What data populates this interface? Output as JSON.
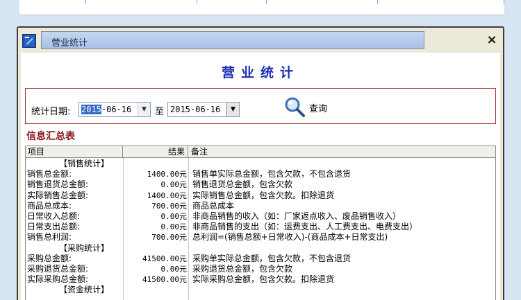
{
  "window": {
    "title": "营业统计",
    "close_symbol": "×"
  },
  "heading": "营业统计",
  "filter": {
    "date_label": "统计日期:",
    "from_year": "2015",
    "from_rest": "-06-16",
    "to_label": "至",
    "to_date": "2015-06-16",
    "query_label": "查询"
  },
  "section_title": "信息汇总表",
  "table": {
    "headers": [
      "项目",
      "结果",
      "备注"
    ],
    "rows": [
      {
        "type": "sec",
        "name": "【销售统计】",
        "value": "",
        "note": ""
      },
      {
        "type": "item",
        "name": "销售总金额:",
        "value": "1400.00元",
        "note": "销售单实际总金额，包含欠款，不包含退货"
      },
      {
        "type": "item",
        "name": "销售退货总金额:",
        "value": "0.00元",
        "note": "销售退货总金额，包含欠款"
      },
      {
        "type": "item",
        "name": "实际销售总金额:",
        "value": "1400.00元",
        "note": "实际销售总金额，包含欠款。扣除退货"
      },
      {
        "type": "item",
        "name": "商品总成本:",
        "value": "700.00元",
        "note": "商品总成本"
      },
      {
        "type": "item",
        "name": "日常收入总额:",
        "value": "0.00元",
        "note": "非商品销售的收入（如：厂家返点收入、废品销售收入）"
      },
      {
        "type": "item",
        "name": "日常支出总额:",
        "value": "0.00元",
        "note": "非商品销售的支出（如：运费支出、人工费支出、电费支出）"
      },
      {
        "type": "item",
        "name": "销售总利润:",
        "value": "700.00元",
        "note": "总利润=(销售总额+日常收入)-(商品成本+日常支出)"
      },
      {
        "type": "sec",
        "name": "【采购统计】",
        "value": "",
        "note": ""
      },
      {
        "type": "item",
        "name": "采购总金额:",
        "value": "41500.00元",
        "note": "采购单实际总金额，包含欠款，不包含退货"
      },
      {
        "type": "item",
        "name": "采购退货总金额:",
        "value": "0.00元",
        "note": "采购退货总金额，包含欠款"
      },
      {
        "type": "item",
        "name": "实际采购总金额:",
        "value": "41500.00元",
        "note": "实际采购总金额，包含欠款。扣除退货"
      },
      {
        "type": "sec",
        "name": "【资金统计】",
        "value": "",
        "note": ""
      }
    ]
  },
  "colors": {
    "heading": "#1a2fb0",
    "section_title": "#8b1a1a",
    "filter_border": "#9e3232",
    "selection": "#316ac5"
  },
  "icons": {
    "app": "app-icon",
    "query": "magnifier-icon",
    "close": "close-icon",
    "dropdown": "chevron-down-icon"
  }
}
